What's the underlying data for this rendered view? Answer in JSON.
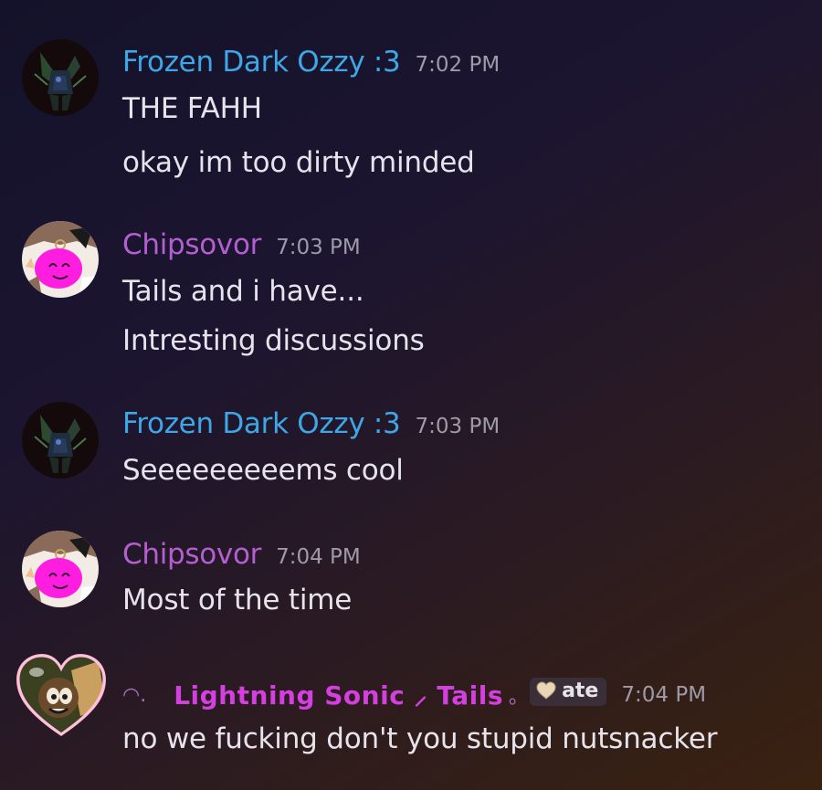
{
  "messages": [
    {
      "username": "Frozen Dark Ozzy :3",
      "time": "7:02 PM",
      "lines": [
        "THE FAHH",
        "okay im too dirty minded"
      ]
    },
    {
      "username": "Chipsovor",
      "time": "7:03 PM",
      "lines": [
        "Tails and i have...",
        "Intresting discussions"
      ]
    },
    {
      "username": "Frozen Dark Ozzy :3",
      "time": "7:03 PM",
      "lines": [
        "Seeeeeeeeems cool"
      ]
    },
    {
      "username": "Chipsovor",
      "time": "7:04 PM",
      "lines": [
        "Most of the time"
      ]
    },
    {
      "username_prefix": "◠.",
      "username": "Lightning Sonic ⸝ Tails",
      "username_suffix": "｡",
      "tag": "ate",
      "time": "7:04 PM",
      "lines": [
        "no we fucking don't you stupid nutsnacker"
      ]
    }
  ],
  "colors": {
    "ozzy_name": "#3ea7e6",
    "chips_name": "#b45fd0",
    "sonic_name": "#d43fe0",
    "timestamp": "#9e9aa8",
    "text": "#e6e3ec"
  }
}
